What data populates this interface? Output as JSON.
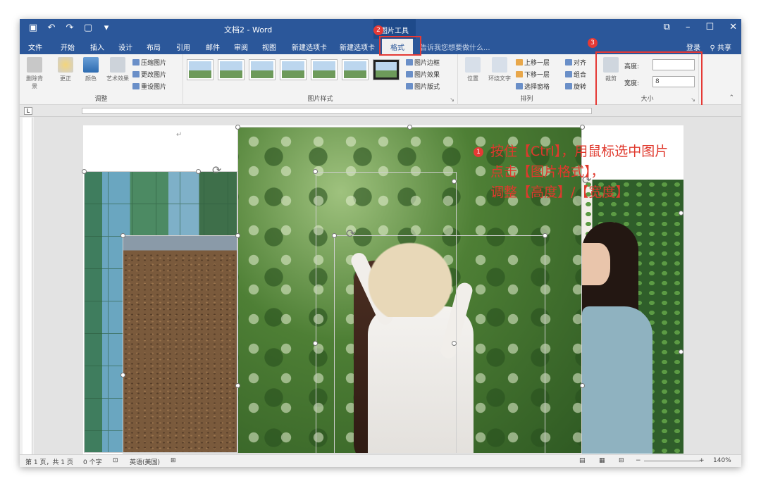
{
  "titlebar": {
    "qat_icons": [
      "save-icon",
      "undo-icon",
      "redo-icon",
      "new-doc-icon",
      "customize-icon"
    ],
    "doc_title": "文档2 - Word",
    "contextual_group": "图片工具"
  },
  "tabs": [
    "文件",
    "开始",
    "插入",
    "设计",
    "布局",
    "引用",
    "邮件",
    "审阅",
    "视图",
    "新建选项卡",
    "新建选项卡",
    "格式"
  ],
  "tell_me": "告诉我您想要做什么...",
  "account": {
    "login": "登录",
    "share": "共享"
  },
  "ribbon": {
    "adjust": {
      "remove_bg": "删除背景",
      "correct": "更正",
      "color": "颜色",
      "art_effect": "艺术效果",
      "compress": "压缩图片",
      "change": "更改图片",
      "reset": "重设图片",
      "label": "调整"
    },
    "styles": {
      "border": "图片边框",
      "effect": "图片效果",
      "layout": "图片版式",
      "label": "图片样式"
    },
    "arrange": {
      "position": "位置",
      "wrap": "环绕文字",
      "forward": "上移一层",
      "backward": "下移一层",
      "select_pane": "选择窗格",
      "align": "对齐",
      "group": "组合",
      "rotate": "旋转",
      "label": "排列"
    },
    "size": {
      "crop": "裁剪",
      "height_label": "高度:",
      "height_value": "",
      "width_label": "宽度:",
      "width_value": "8",
      "label": "大小"
    }
  },
  "badges": {
    "one": "1",
    "two": "2",
    "three": "3"
  },
  "annotation": {
    "line1": "按住【Ctrl】，用鼠标选中图片",
    "line2": "点击【图片格式】，",
    "line3": "调整【高度】/【宽度】"
  },
  "statusbar": {
    "page": "第 1 页，共 1 页",
    "words": "0 个字",
    "lang": "英语(美国)",
    "zoom": "140%"
  },
  "colors": {
    "title_bg": "#2b579a",
    "accent_red": "#e53935",
    "annotation": "#e0392d"
  }
}
